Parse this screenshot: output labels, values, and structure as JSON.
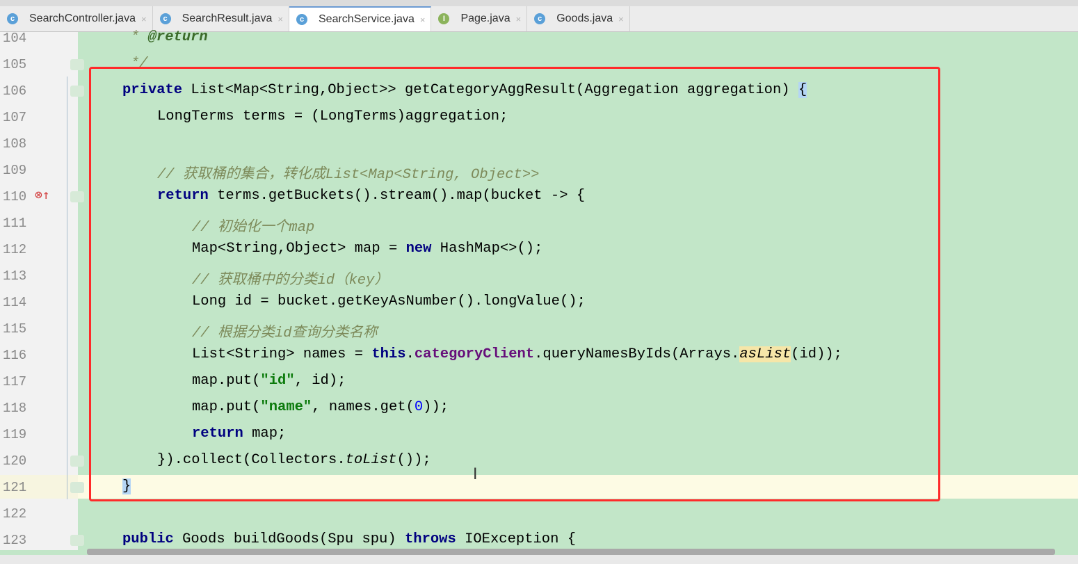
{
  "tabs": [
    {
      "name": "SearchController.java",
      "icon": "class-icon",
      "icon_letter": "c",
      "close": "×"
    },
    {
      "name": "SearchResult.java",
      "icon": "class-icon",
      "icon_letter": "c",
      "close": "×"
    },
    {
      "name": "SearchService.java",
      "icon": "class-icon",
      "icon_letter": "c",
      "close": "×",
      "active": true
    },
    {
      "name": "Page.java",
      "icon": "interface-icon",
      "icon_letter": "I",
      "close": "×"
    },
    {
      "name": "Goods.java",
      "icon": "class-icon",
      "icon_letter": "c",
      "close": "×"
    }
  ],
  "line_numbers": [
    "104",
    "105",
    "106",
    "107",
    "108",
    "109",
    "110",
    "111",
    "112",
    "113",
    "114",
    "115",
    "116",
    "117",
    "118",
    "119",
    "120",
    "121",
    "122",
    "123"
  ],
  "gutter_marker": "⊗↑",
  "code": {
    "l104_star": "* ",
    "l104_tag": "@return",
    "l105": "*/",
    "l106_kw": "private",
    "l106_rest": " List<Map<String,Object>> getCategoryAggResult(Aggregation aggregation) ",
    "l106_brace": "{",
    "l107": "LongTerms terms = (LongTerms)aggregation;",
    "l109": "// 获取桶的集合，转化成List<Map<String, Object>>",
    "l110_kw": "return",
    "l110_rest": " terms.getBuckets().stream().map(bucket -> {",
    "l111": "// 初始化一个map",
    "l112_a": "Map<String,Object> map = ",
    "l112_kw": "new",
    "l112_b": " HashMap<>();",
    "l113": "// 获取桶中的分类id（key）",
    "l114": "Long id = bucket.getKeyAsNumber().longValue();",
    "l115": "// 根据分类id查询分类名称",
    "l116_a": "List<String> names = ",
    "l116_kw": "this",
    "l116_dot": ".",
    "l116_fld": "categoryClient",
    "l116_b": ".queryNamesByIds(Arrays.",
    "l116_st": "asList",
    "l116_c": "(id));",
    "l117_a": "map.put(",
    "l117_str": "\"id\"",
    "l117_b": ", id);",
    "l118_a": "map.put(",
    "l118_str": "\"name\"",
    "l118_b": ", names.get(",
    "l118_num": "0",
    "l118_c": "));",
    "l119_kw": "return",
    "l119_rest": " map;",
    "l120_a": "}).collect(Collectors.",
    "l120_st": "toList",
    "l120_b": "());",
    "l121": "}",
    "l123_kw": "public",
    "l123_a": " Goods buildGoods(Spu spu) ",
    "l123_kw2": "throws",
    "l123_b": " IOException {"
  }
}
